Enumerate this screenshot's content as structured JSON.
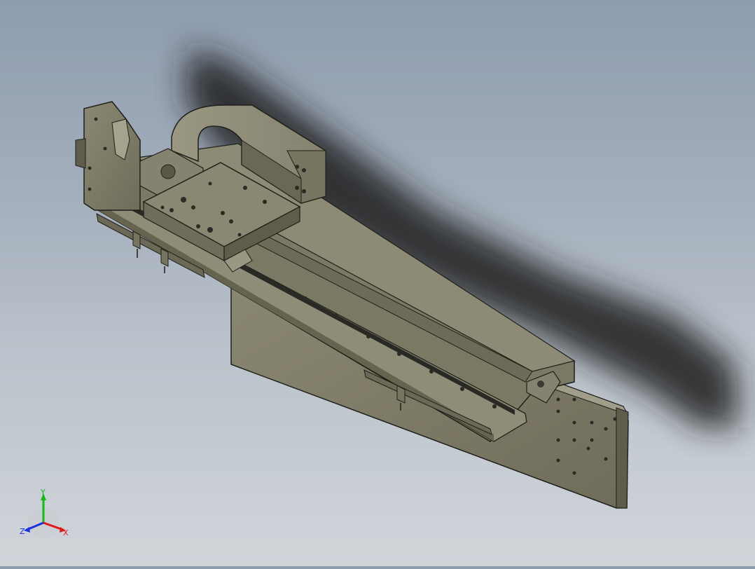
{
  "triad": {
    "x_label": "X",
    "y_label": "Y",
    "z_label": "Z",
    "x_color": "#e01818",
    "y_color": "#18b818",
    "z_color": "#1830e0"
  },
  "model": {
    "body_color": "#7d7a66",
    "edge_color": "#1f1f1a",
    "rail_color": "#8f8c78"
  }
}
